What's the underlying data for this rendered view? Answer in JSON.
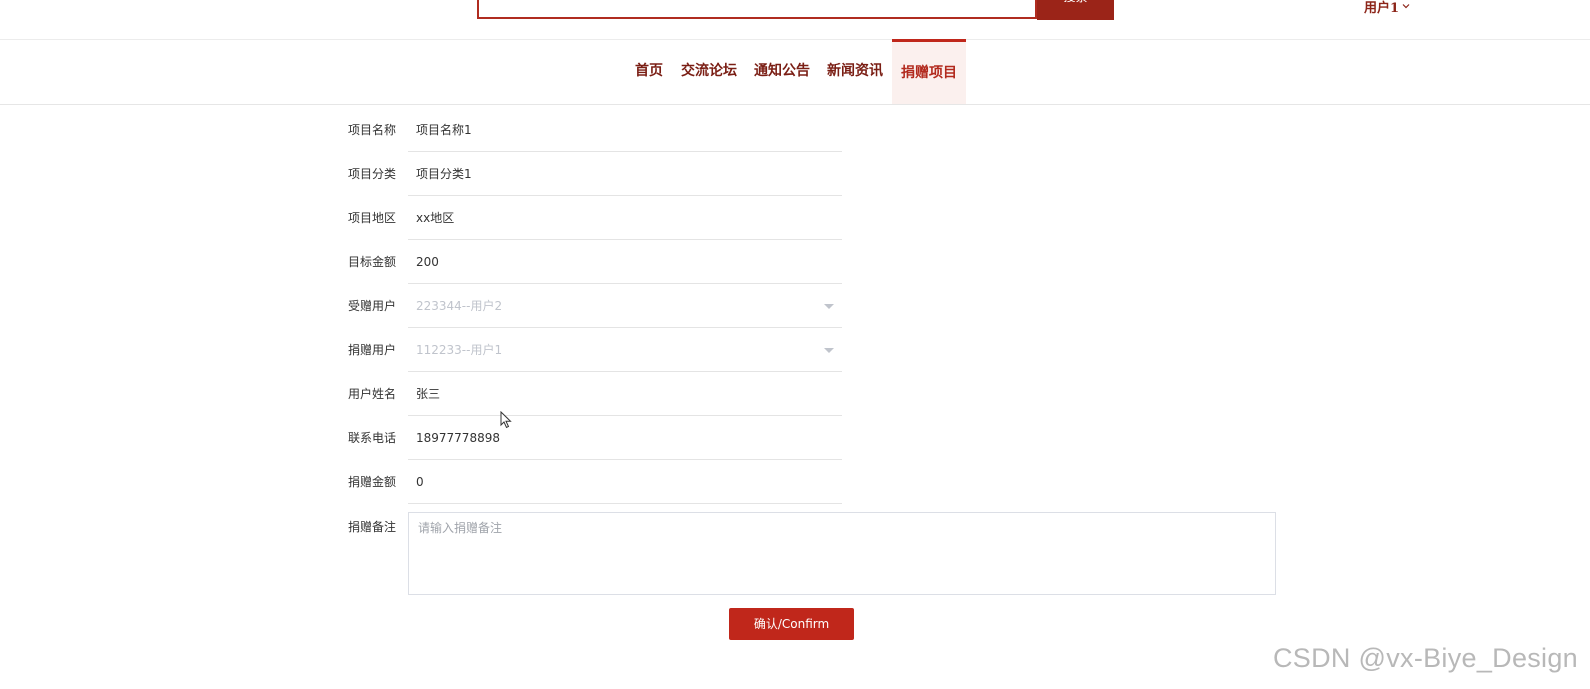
{
  "header": {
    "search_button_label": "搜索",
    "user_label": "用户1"
  },
  "nav": {
    "items": [
      {
        "label": "首页"
      },
      {
        "label": "交流论坛"
      },
      {
        "label": "通知公告"
      },
      {
        "label": "新闻资讯"
      },
      {
        "label": "捐赠项目",
        "active": true
      }
    ]
  },
  "form": {
    "fields": [
      {
        "label": "项目名称",
        "value": "项目名称1"
      },
      {
        "label": "项目分类",
        "value": "项目分类1"
      },
      {
        "label": "项目地区",
        "value": "xx地区"
      },
      {
        "label": "目标金额",
        "value": "200"
      },
      {
        "label": "受赠用户",
        "value": "223344--用户2",
        "type": "select",
        "disabled": true
      },
      {
        "label": "捐赠用户",
        "value": "112233--用户1",
        "type": "select",
        "disabled": true
      },
      {
        "label": "用户姓名",
        "value": "张三"
      },
      {
        "label": "联系电话",
        "value": "18977778898"
      },
      {
        "label": "捐赠金额",
        "value": "0"
      }
    ],
    "remark": {
      "label": "捐赠备注",
      "placeholder": "请输入捐赠备注",
      "value": ""
    },
    "confirm_label": "确认/Confirm"
  },
  "watermark": "CSDN @vx-Biye_Design",
  "colors": {
    "brand_red": "#c0271b",
    "dark_red": "#9b2418",
    "nav_text": "#7a1e14",
    "active_nav_bg": "#fbf0ee"
  }
}
